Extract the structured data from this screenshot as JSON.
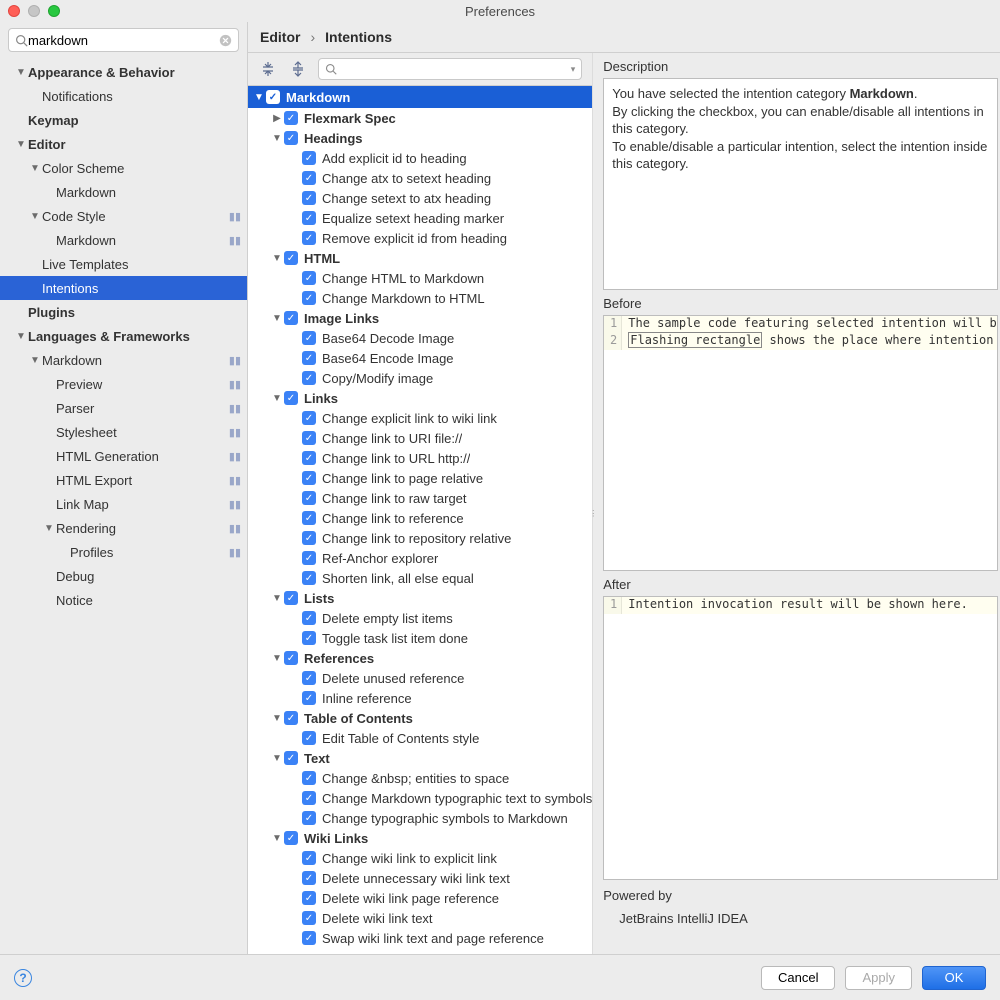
{
  "window": {
    "title": "Preferences"
  },
  "sidebar": {
    "search": {
      "value": "markdown"
    },
    "items": [
      {
        "label": "Appearance & Behavior",
        "bold": true,
        "indent": 1,
        "disc": "down"
      },
      {
        "label": "Notifications",
        "indent": 2
      },
      {
        "label": "Keymap",
        "bold": true,
        "indent": 1
      },
      {
        "label": "Editor",
        "bold": true,
        "indent": 1,
        "disc": "down"
      },
      {
        "label": "Color Scheme",
        "indent": 2,
        "disc": "down"
      },
      {
        "label": "Markdown",
        "indent": 3
      },
      {
        "label": "Code Style",
        "indent": 2,
        "disc": "down",
        "icon": true
      },
      {
        "label": "Markdown",
        "indent": 3,
        "icon": true
      },
      {
        "label": "Live Templates",
        "indent": 2
      },
      {
        "label": "Intentions",
        "indent": 2,
        "selected": true
      },
      {
        "label": "Plugins",
        "bold": true,
        "indent": 1
      },
      {
        "label": "Languages & Frameworks",
        "bold": true,
        "indent": 1,
        "disc": "down"
      },
      {
        "label": "Markdown",
        "indent": 2,
        "disc": "down",
        "icon": true
      },
      {
        "label": "Preview",
        "indent": 3,
        "icon": true
      },
      {
        "label": "Parser",
        "indent": 3,
        "icon": true
      },
      {
        "label": "Stylesheet",
        "indent": 3,
        "icon": true
      },
      {
        "label": "HTML Generation",
        "indent": 3,
        "icon": true
      },
      {
        "label": "HTML Export",
        "indent": 3,
        "icon": true
      },
      {
        "label": "Link Map",
        "indent": 3,
        "icon": true
      },
      {
        "label": "Rendering",
        "indent": 3,
        "disc": "down",
        "icon": true
      },
      {
        "label": "Profiles",
        "indent": 4,
        "icon": true
      },
      {
        "label": "Debug",
        "indent": 3
      },
      {
        "label": "Notice",
        "indent": 3
      }
    ]
  },
  "breadcrumb": {
    "a": "Editor",
    "b": "Intentions"
  },
  "toolbar": {
    "search_placeholder": ""
  },
  "intentions": {
    "root": "Markdown",
    "groups": [
      {
        "label": "Flexmark Spec",
        "disc": "right",
        "items": []
      },
      {
        "label": "Headings",
        "disc": "down",
        "items": [
          "Add explicit id to heading",
          "Change atx to setext heading",
          "Change setext to atx heading",
          "Equalize setext heading marker",
          "Remove explicit id from heading"
        ]
      },
      {
        "label": "HTML",
        "disc": "down",
        "items": [
          "Change HTML to Markdown",
          "Change Markdown to HTML"
        ]
      },
      {
        "label": "Image Links",
        "disc": "down",
        "items": [
          "Base64 Decode Image",
          "Base64 Encode Image",
          "Copy/Modify image"
        ]
      },
      {
        "label": "Links",
        "disc": "down",
        "items": [
          "Change explicit link to wiki link",
          "Change link to URI file://",
          "Change link to URL http://",
          "Change link to page relative",
          "Change link to raw target",
          "Change link to reference",
          "Change link to repository relative",
          "Ref-Anchor explorer",
          "Shorten link, all else equal"
        ]
      },
      {
        "label": "Lists",
        "disc": "down",
        "items": [
          "Delete empty list items",
          "Toggle task list item done"
        ]
      },
      {
        "label": "References",
        "disc": "down",
        "items": [
          "Delete unused reference",
          "Inline reference"
        ]
      },
      {
        "label": "Table of Contents",
        "disc": "down",
        "items": [
          "Edit Table of Contents style"
        ]
      },
      {
        "label": "Text",
        "disc": "down",
        "items": [
          "Change &nbsp; entities to space",
          "Change Markdown typographic text to symbols",
          "Change typographic symbols to Markdown"
        ]
      },
      {
        "label": "Wiki Links",
        "disc": "down",
        "items": [
          "Change wiki link to explicit link",
          "Delete unnecessary wiki link text",
          "Delete wiki link page reference",
          "Delete wiki link text",
          "Swap wiki link text and page reference"
        ]
      }
    ]
  },
  "desc": {
    "label": "Description",
    "l1a": "You have selected the intention category ",
    "l1b": "Markdown",
    "l1c": ".",
    "l2": "By clicking the checkbox, you can enable/disable all intentions in this category.",
    "l3": "To enable/disable a particular intention, select the intention inside this category."
  },
  "before": {
    "label": "Before",
    "lines": [
      {
        "n": "1",
        "pre": "The sample code featuring selected intention will b"
      },
      {
        "n": "2",
        "pre": "",
        "hl": "Flashing rectangle",
        "post": " shows the place where intention "
      }
    ]
  },
  "after": {
    "label": "After",
    "lines": [
      {
        "n": "1",
        "t": "Intention invocation result will be shown here."
      }
    ]
  },
  "powered": {
    "label": "Powered by",
    "name": "JetBrains IntelliJ IDEA"
  },
  "buttons": {
    "cancel": "Cancel",
    "apply": "Apply",
    "ok": "OK"
  }
}
